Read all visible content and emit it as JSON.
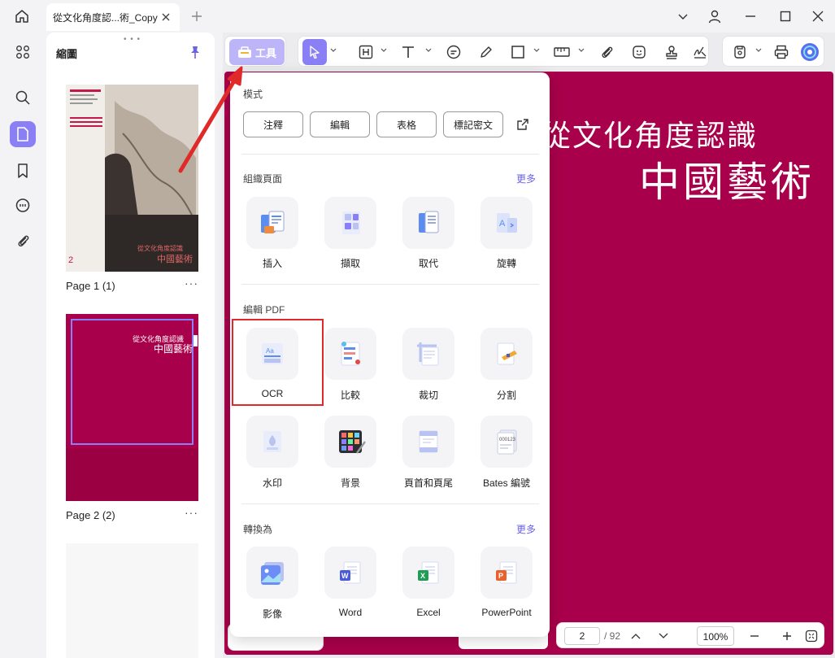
{
  "titlebar": {
    "tab_title": "從文化角度認...術_Copy"
  },
  "thumb_panel": {
    "title": "縮圖",
    "pages": [
      {
        "label": "Page 1 (1)"
      },
      {
        "label": "Page 2 (2)"
      }
    ],
    "page1_thumb": {
      "number": "2",
      "sub": "從文化角度認識",
      "main": "中國藝術"
    },
    "page2_thumb": {
      "sub": "從文化角度認識",
      "main": "中國藝術"
    }
  },
  "toolbar": {
    "tools_label": "工具"
  },
  "page_view": {
    "subtitle": "從文化角度認識",
    "title": "中國藝術"
  },
  "bottombar": {
    "page_value": "2",
    "page_total": "/ 92",
    "zoom": "100%"
  },
  "tools_panel": {
    "mode": {
      "title": "模式",
      "buttons": [
        "注釋",
        "編輯",
        "表格",
        "標記密文"
      ]
    },
    "organize": {
      "title": "組織頁面",
      "more": "更多",
      "items": [
        "插入",
        "擷取",
        "取代",
        "旋轉"
      ]
    },
    "edit": {
      "title": "編輯 PDF",
      "items": [
        "OCR",
        "比較",
        "裁切",
        "分割",
        "水印",
        "背景",
        "頁首和頁尾",
        "Bates 編號"
      ]
    },
    "convert": {
      "title": "轉換為",
      "more": "更多",
      "items": [
        "影像",
        "Word",
        "Excel",
        "PowerPoint"
      ]
    }
  },
  "colors": {
    "accent": "#8a7ff5",
    "page_bg": "#a8004a",
    "highlight": "#e02a2a"
  }
}
